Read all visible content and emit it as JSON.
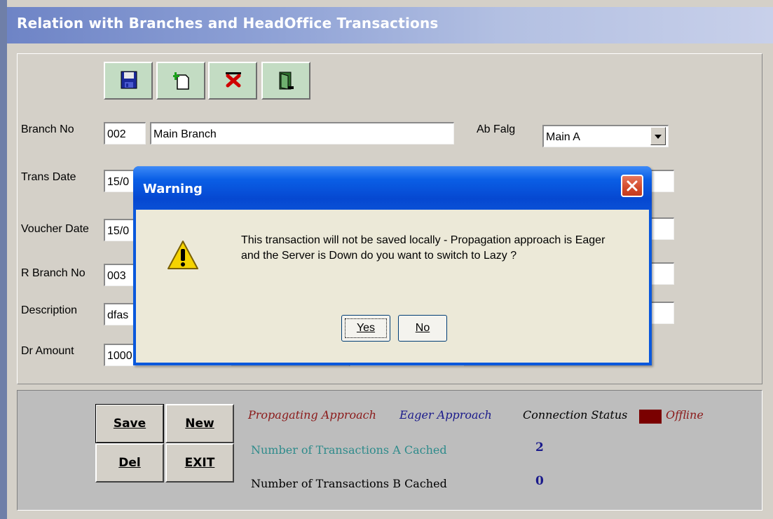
{
  "window": {
    "title": "Relation with Branches and HeadOffice Transactions"
  },
  "toolbar": {
    "buttons": [
      {
        "icon": "floppy-disk-icon",
        "name": "save"
      },
      {
        "icon": "new-document-icon",
        "name": "new"
      },
      {
        "icon": "delete-x-icon",
        "name": "delete"
      },
      {
        "icon": "exit-door-icon",
        "name": "exit"
      }
    ]
  },
  "form": {
    "branch_no_label": "Branch No",
    "branch_no_code": "002",
    "branch_no_name": "Main Branch",
    "ab_flag_label": "Ab Falg",
    "ab_flag_value": "Main A",
    "trans_date_label": "Trans Date",
    "trans_date_value": "15/0",
    "voucher_date_label": "Voucher Date",
    "voucher_date_value": "15/0",
    "r_branch_no_label": "R Branch No",
    "r_branch_no_value": "003",
    "description_label": "Description",
    "description_value": "dfas",
    "dr_amount_label": "Dr Amount",
    "dr_amount_value": "1000"
  },
  "actions": {
    "save": "Save",
    "new": "New",
    "del": "Del",
    "exit": "EXIT"
  },
  "status": {
    "propagating_label": "Propagating Approach",
    "approach_value": "Eager Approach",
    "connection_label": "Connection Status",
    "connection_value": "Offline",
    "connection_color": "#7a0000",
    "cached_a_label": "Number of Transactions A Cached",
    "cached_a_value": "2",
    "cached_b_label": "Number of Transactions B Cached",
    "cached_b_value": "0"
  },
  "dialog": {
    "title": "Warning",
    "message": "This transaction will not be saved locally - Propagation approach is Eager and the Server is Down do you want to switch to Lazy ?",
    "yes": "Yes",
    "no": "No"
  },
  "colors": {
    "title_bar": "#7f93cf",
    "xp_blue": "#0a58dc",
    "toolbar_btn": "#c3dcc3",
    "propagating_text": "#8b1a1a",
    "approach_text": "#1a1a8b",
    "cached_a_text": "#2e8b8b",
    "count_text": "#1a1a8b"
  }
}
